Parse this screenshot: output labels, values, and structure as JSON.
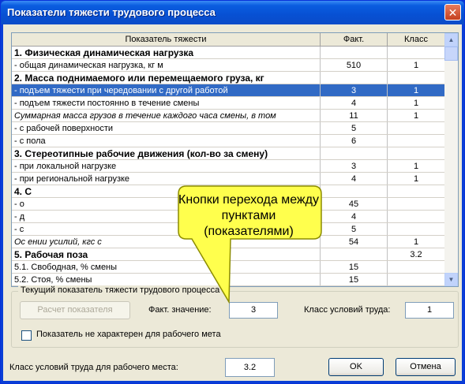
{
  "window": {
    "title": "Показатели тяжести трудового процесса",
    "close_glyph": "✕"
  },
  "grid": {
    "headers": [
      "Показатель тяжести",
      "Факт.",
      "Класс"
    ],
    "rows": [
      {
        "name": "1. Физическая динамическая нагрузка",
        "fact": "",
        "cls": "",
        "style": "section"
      },
      {
        "name": "- общая динамическая нагрузка, кг м",
        "fact": "510",
        "cls": "1",
        "style": ""
      },
      {
        "name": "2. Масса поднимаемого или перемещаемого груза, кг",
        "fact": "",
        "cls": "",
        "style": "section"
      },
      {
        "name": "- подъем тяжести при чередовании с другой работой",
        "fact": "3",
        "cls": "1",
        "style": "selected"
      },
      {
        "name": "- подъем тяжести постоянно в течение смены",
        "fact": "4",
        "cls": "1",
        "style": ""
      },
      {
        "name": "Суммарная масса грузов в течение каждого часа смены, в том",
        "fact": "11",
        "cls": "1",
        "style": "italic"
      },
      {
        "name": "- с рабочей поверхности",
        "fact": "5",
        "cls": "",
        "style": ""
      },
      {
        "name": "- с пола",
        "fact": "6",
        "cls": "",
        "style": ""
      },
      {
        "name": "3. Стереотипные рабочие движения (кол-во за смену)",
        "fact": "",
        "cls": "",
        "style": "section"
      },
      {
        "name": "- при локальной нагрузке",
        "fact": "3",
        "cls": "1",
        "style": ""
      },
      {
        "name": "- при региональной нагрузке",
        "fact": "4",
        "cls": "1",
        "style": ""
      },
      {
        "name": "4. С",
        "fact": "",
        "cls": "",
        "style": "section"
      },
      {
        "name": "- о",
        "fact": "45",
        "cls": "",
        "style": ""
      },
      {
        "name": "- д",
        "fact": "4",
        "cls": "",
        "style": ""
      },
      {
        "name": "- с",
        "fact": "5",
        "cls": "",
        "style": ""
      },
      {
        "name": "Ос                                                   ении усилий, кгс с",
        "fact": "54",
        "cls": "1",
        "style": "italic"
      },
      {
        "name": "5. Рабочая поза",
        "fact": "",
        "cls": "3.2",
        "style": "section"
      },
      {
        "name": "5.1. Свободная, % смены",
        "fact": "15",
        "cls": "",
        "style": ""
      },
      {
        "name": "5.2. Стоя, % смены",
        "fact": "15",
        "cls": "",
        "style": ""
      }
    ],
    "scroll_up_glyph": "▲",
    "scroll_down_glyph": "▼"
  },
  "current": {
    "legend": "Текущий показатель тяжести трудового процесса",
    "calc_button": "Расчет показателя",
    "fact_label": "Факт. значение:",
    "fact_value": "3",
    "class_label": "Класс условий труда:",
    "class_value": "1",
    "checkbox_label": "Показатель не характерен для рабочего мета"
  },
  "footer": {
    "workplace_class_label": "Класс условий труда для рабочего места:",
    "workplace_class_value": "3.2",
    "ok_label": "OK",
    "cancel_label": "Отмена"
  },
  "callout": {
    "text": "Кнопки перехода между пунктами (показателями)",
    "fill_color": "#ffff4d",
    "border_color": "#8c8c00"
  },
  "colors": {
    "selection": "#316ac5",
    "titlebar": "#0a5de0",
    "dialog_bg": "#ece9d8"
  }
}
